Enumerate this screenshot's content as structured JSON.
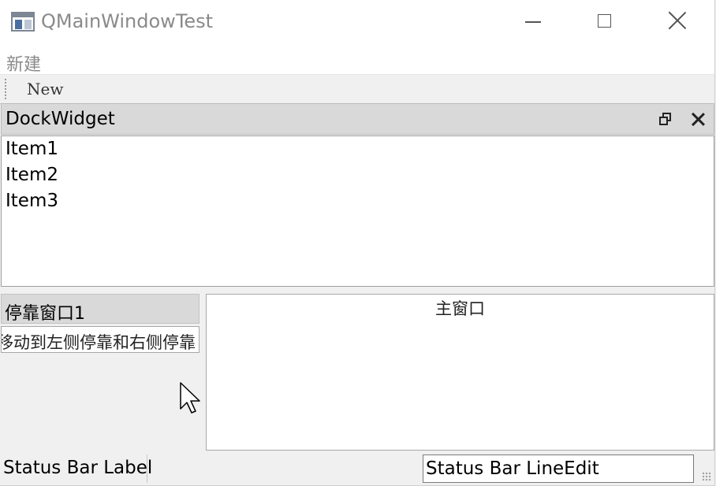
{
  "window": {
    "title": "QMainWindowTest",
    "icon": "app-window-icon",
    "buttons": {
      "minimize": "minimize-icon",
      "maximize": "maximize-icon",
      "close": "close-icon"
    }
  },
  "menubar": {
    "items": [
      {
        "label": "新建"
      }
    ]
  },
  "toolbar": {
    "actions": [
      {
        "label": "New"
      }
    ]
  },
  "dock_top": {
    "title": "DockWidget",
    "items": [
      "Item1",
      "Item2",
      "Item3"
    ]
  },
  "dock_left": {
    "title": "停靠窗口1",
    "content": "可移动到左侧停靠和右侧停靠"
  },
  "central": {
    "label": "主窗口"
  },
  "statusbar": {
    "label": "Status Bar Label",
    "lineedit_value": "Status Bar LineEdit"
  }
}
